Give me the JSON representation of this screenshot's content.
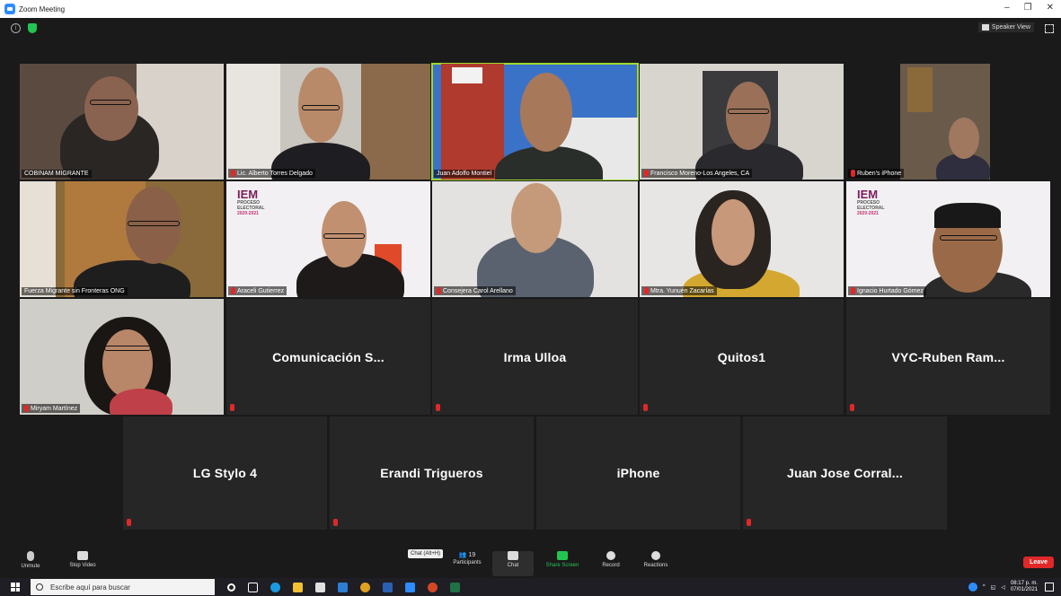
{
  "window": {
    "title": "Zoom Meeting"
  },
  "top_bar": {
    "speaker_view_label": "Speaker View"
  },
  "tiles_video": [
    {
      "name": "COBINAM MIGRANTE"
    },
    {
      "name": "Lic. Alberto Torres Delgado"
    },
    {
      "name": "Juan Adolfo Montiel"
    },
    {
      "name": "Francisco Moreno-Los Angeles, CA"
    },
    {
      "name": "Ruben's iPhone"
    },
    {
      "name": "Fuerza Migrante sin Fronteras ONG"
    },
    {
      "name": "Araceli Gutierrez"
    },
    {
      "name": "Consejera Carol Arellano"
    },
    {
      "name": "Mtra. Yunuén Zacarías"
    },
    {
      "name": "Ignacio Hurtado Gómez"
    },
    {
      "name": "Miryam Martínez"
    }
  ],
  "iem_logo": {
    "brand": "IEM",
    "line1": "PROCESO",
    "line2": "ELECTORAL",
    "years": "2020-2021"
  },
  "tiles_name": [
    {
      "name": "Comunicación S..."
    },
    {
      "name": "Irma Ulloa"
    },
    {
      "name": "Quitos1"
    },
    {
      "name": "VYC-Ruben Ram..."
    },
    {
      "name": "LG Stylo 4"
    },
    {
      "name": "Erandi Trigueros"
    },
    {
      "name": "iPhone"
    },
    {
      "name": "Juan Jose Corral..."
    }
  ],
  "toolbar": {
    "unmute": "Unmute",
    "stop_video": "Stop Video",
    "participants": "Participants",
    "participants_count": "19",
    "chat": "Chat",
    "chat_tooltip": "Chat (Alt+H)",
    "share_screen": "Share Screen",
    "record": "Record",
    "reactions": "Reactions",
    "leave": "Leave"
  },
  "taskbar": {
    "search_placeholder": "Escribe aquí para buscar",
    "time": "08:17 p. m.",
    "date": "07/01/2021"
  },
  "colors": {
    "active_speaker": "#a0d830",
    "leave": "#e02828",
    "share": "#23c552"
  }
}
